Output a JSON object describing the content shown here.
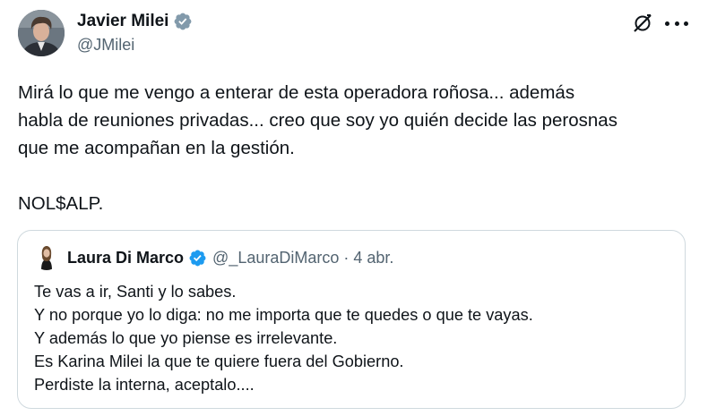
{
  "author": {
    "name": "Javier Milei",
    "handle": "@JMilei"
  },
  "header_icons": [
    "verified-badge-icon",
    "grok-icon",
    "more-options-icon"
  ],
  "tweet": {
    "text": "Mirá lo que me vengo a enterar de esta operadora roñosa... además\nhabla de reuniones privadas... creo que soy yo quién decide las perosnas\nque me acompañan en la gestión.\n\nNOL$ALP."
  },
  "quoted_tweet": {
    "author_name": "Laura Di Marco",
    "handle": "@_LauraDiMarco",
    "separator": "·",
    "date": "4 abr.",
    "text": "Te vas a ir, Santi y lo sabes.\nY no porque yo lo diga: no me importa que te quedes o que te vayas.\nY además lo que yo piense es irrelevante.\nEs Karina Milei la que te quiere fuera del Gobierno.\nPerdiste la interna, aceptalo...."
  },
  "colors": {
    "text_primary": "#0f1419",
    "text_secondary": "#536471",
    "border": "#cfd9de",
    "verified_gray": "#829aab",
    "verified_blue": "#1d9bf0"
  }
}
